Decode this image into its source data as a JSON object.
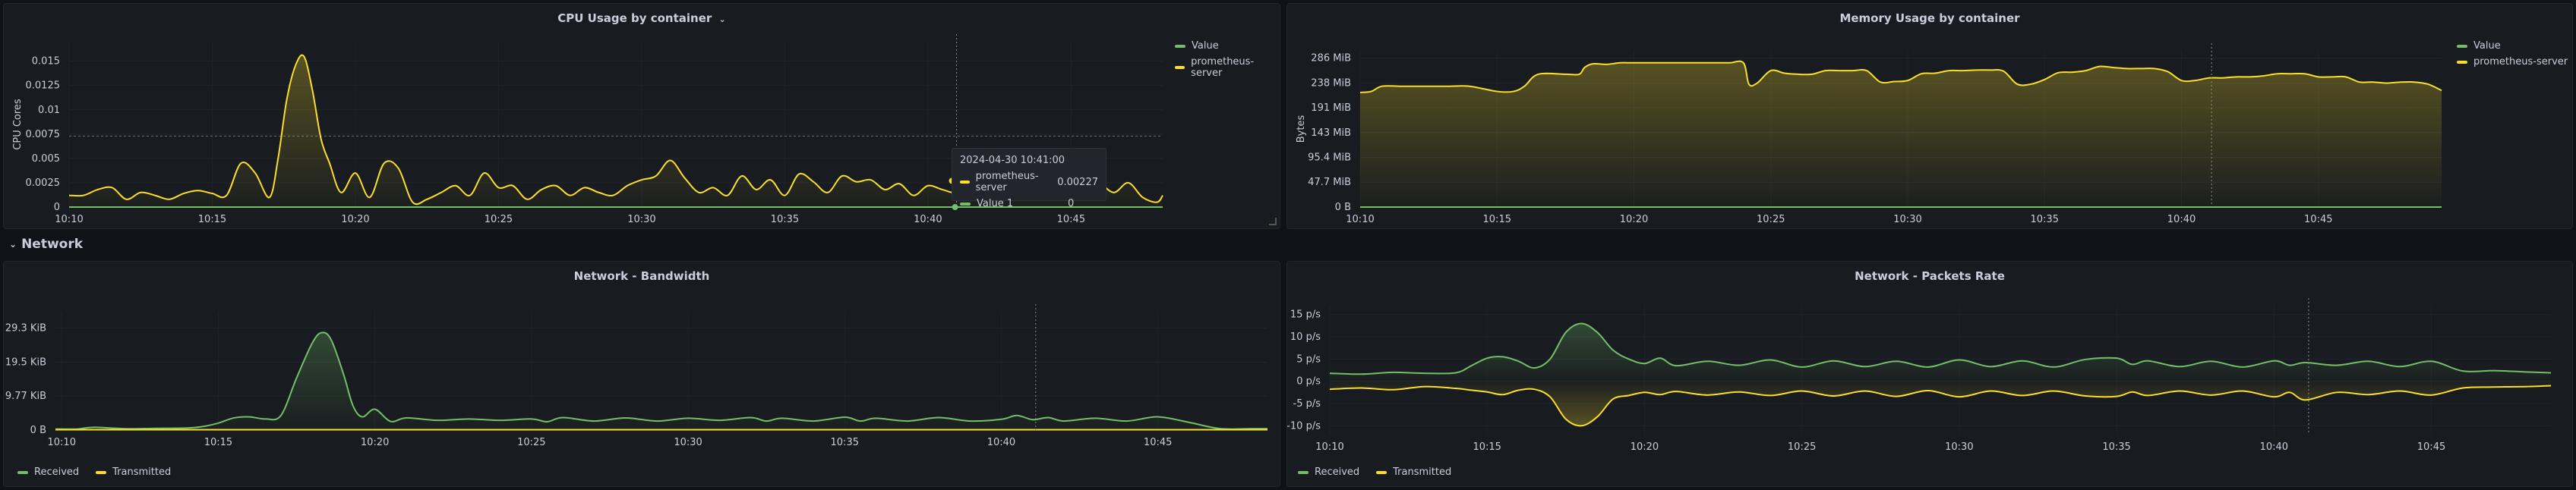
{
  "colors": {
    "green": "#73bf69",
    "yellow": "#fade2a",
    "bg": "#181b1f",
    "grid": "#2a2d33"
  },
  "row": {
    "label": "Network"
  },
  "panels": {
    "cpu": {
      "title": "CPU Usage by container",
      "legend": [
        "Value",
        "prometheus-server"
      ],
      "tooltip": {
        "time": "2024-04-30 10:41:00",
        "rows": [
          {
            "label": "prometheus-server",
            "value": "0.00227",
            "color": "#fade2a"
          },
          {
            "label": "Value 1",
            "value": "0",
            "color": "#73bf69"
          }
        ]
      }
    },
    "mem": {
      "title": "Memory Usage by container",
      "legend": [
        "Value",
        "prometheus-server"
      ]
    },
    "bw": {
      "title": "Network - Bandwidth",
      "legend": [
        "Received",
        "Transmitted"
      ]
    },
    "pkt": {
      "title": "Network - Packets Rate",
      "legend": [
        "Received",
        "Transmitted"
      ]
    }
  },
  "chart_data": [
    {
      "type": "line",
      "title": "CPU Usage by container",
      "ylabel": "CPU Cores",
      "ylim": [
        0,
        0.017
      ],
      "yticks": [
        "0",
        "0.0025",
        "0.005",
        "0.0075",
        "0.01",
        "0.0125",
        "0.015"
      ],
      "ytick_values": [
        0,
        0.0025,
        0.005,
        0.0075,
        0.01,
        0.0125,
        0.015
      ],
      "xlim": [
        10.0,
        48.2
      ],
      "xticks": [
        "10:10",
        "10:15",
        "10:20",
        "10:25",
        "10:30",
        "10:35",
        "10:40",
        "10:45"
      ],
      "xtick_values": [
        10,
        15,
        20,
        25,
        30,
        35,
        40,
        45
      ],
      "threshold_dashed": 0.0073,
      "cursor_x": 41.0,
      "series": [
        {
          "name": "Value",
          "color": "#73bf69",
          "x": [
            10,
            48.2
          ],
          "y": [
            0,
            0
          ]
        },
        {
          "name": "prometheus-server",
          "color": "#fade2a",
          "x": [
            10,
            10.5,
            11,
            11.5,
            12,
            12.5,
            13,
            13.5,
            14,
            14.5,
            15,
            15.5,
            16,
            16.5,
            17,
            17.3,
            17.6,
            17.9,
            18.2,
            18.5,
            18.8,
            19.1,
            19.5,
            20,
            20.5,
            21,
            21.5,
            22,
            22.5,
            23,
            23.5,
            24,
            24.5,
            25,
            25.5,
            26,
            26.5,
            27,
            27.5,
            28,
            28.5,
            29,
            29.5,
            30,
            30.5,
            31,
            31.5,
            32,
            32.5,
            33,
            33.5,
            34,
            34.5,
            35,
            35.5,
            36,
            36.5,
            37,
            37.5,
            38,
            38.5,
            39,
            39.5,
            40,
            40.5,
            41,
            41.5,
            42,
            42.5,
            43,
            43.5,
            44,
            44.5,
            45,
            45.5,
            46,
            46.5,
            47,
            47.5,
            48,
            48.2
          ],
          "y": [
            0.0012,
            0.0012,
            0.0018,
            0.002,
            0.0008,
            0.0015,
            0.0012,
            0.0008,
            0.0014,
            0.0017,
            0.0014,
            0.0012,
            0.0045,
            0.0035,
            0.001,
            0.005,
            0.011,
            0.0145,
            0.0155,
            0.012,
            0.007,
            0.0045,
            0.0015,
            0.0035,
            0.001,
            0.0045,
            0.004,
            0.0005,
            0.0008,
            0.0015,
            0.0022,
            0.0012,
            0.0035,
            0.002,
            0.0022,
            0.0008,
            0.0018,
            0.0022,
            0.0012,
            0.002,
            0.0015,
            0.0012,
            0.0022,
            0.0028,
            0.0032,
            0.0048,
            0.003,
            0.0015,
            0.002,
            0.0012,
            0.0032,
            0.0018,
            0.0028,
            0.0012,
            0.0034,
            0.0026,
            0.0015,
            0.0032,
            0.0026,
            0.0028,
            0.0018,
            0.0024,
            0.0012,
            0.0022,
            0.0018,
            0.0015,
            0.0025,
            0.0032,
            0.0015,
            0.0052,
            0.004,
            0.003,
            0.0055,
            0.0015,
            0.0032,
            0.0025,
            0.0015,
            0.0025,
            0.001,
            0.0005,
            0.0012
          ]
        }
      ]
    },
    {
      "type": "area",
      "title": "Memory Usage by container",
      "ylabel": "Bytes",
      "ylim": [
        0,
        300
      ],
      "yticks": [
        "0 B",
        "47.7 MiB",
        "95.4 MiB",
        "143 MiB",
        "191 MiB",
        "238 MiB",
        "286 MiB"
      ],
      "ytick_values": [
        0,
        47.7,
        95.4,
        143,
        191,
        238,
        286
      ],
      "xlim": [
        10.0,
        49.5
      ],
      "xticks": [
        "10:10",
        "10:15",
        "10:20",
        "10:25",
        "10:30",
        "10:35",
        "10:40",
        "10:45"
      ],
      "xtick_values": [
        10,
        15,
        20,
        25,
        30,
        35,
        40,
        45
      ],
      "cursor_x": 41.1,
      "series": [
        {
          "name": "Value",
          "color": "#73bf69",
          "x": [
            10,
            49.5
          ],
          "y": [
            0,
            0
          ]
        },
        {
          "name": "prometheus-server",
          "color": "#fade2a",
          "x": [
            10,
            10.4,
            10.8,
            11.5,
            12.5,
            13.2,
            14,
            15,
            15.6,
            16,
            16.5,
            17.5,
            18,
            18.2,
            18.5,
            19,
            19.5,
            20,
            21,
            22,
            23,
            23.5,
            24,
            24.2,
            24.5,
            25,
            25.5,
            26,
            26.5,
            27,
            27.5,
            28,
            28.5,
            29,
            29.5,
            30,
            30.5,
            31,
            31.5,
            32,
            32.5,
            33,
            33.5,
            34,
            34.5,
            35,
            35.5,
            36,
            36.5,
            37,
            37.5,
            38,
            38.5,
            39,
            39.5,
            40,
            40.5,
            41,
            41.5,
            42,
            42.5,
            43,
            43.5,
            44,
            44.5,
            45,
            45.5,
            46,
            46.5,
            47,
            47.5,
            48,
            48.5,
            49,
            49.5
          ],
          "y": [
            220,
            222,
            232,
            232,
            232,
            232,
            232,
            222,
            222,
            232,
            255,
            255,
            255,
            268,
            275,
            274,
            277,
            277,
            277,
            277,
            277,
            277,
            277,
            236,
            238,
            262,
            257,
            255,
            255,
            262,
            262,
            262,
            262,
            240,
            241,
            243,
            256,
            257,
            262,
            262,
            263,
            263,
            261,
            236,
            236,
            245,
            258,
            259,
            262,
            270,
            268,
            266,
            266,
            266,
            260,
            243,
            243,
            248,
            248,
            250,
            250,
            252,
            256,
            256,
            256,
            250,
            250,
            250,
            240,
            240,
            238,
            240,
            240,
            236,
            224
          ]
        }
      ]
    },
    {
      "type": "area",
      "title": "Network - Bandwidth",
      "ylim": [
        0,
        34
      ],
      "yticks": [
        "0 B",
        "9.77 KiB",
        "19.5 KiB",
        "29.3 KiB"
      ],
      "ytick_values": [
        0,
        9.77,
        19.5,
        29.3
      ],
      "xlim": [
        9.8,
        48.5
      ],
      "xticks": [
        "10:10",
        "10:15",
        "10:20",
        "10:25",
        "10:30",
        "10:35",
        "10:40",
        "10:45"
      ],
      "xtick_values": [
        10,
        15,
        20,
        25,
        30,
        35,
        40,
        45
      ],
      "cursor_x": 41.1,
      "series": [
        {
          "name": "Received",
          "color": "#73bf69",
          "x": [
            9.8,
            10.5,
            11,
            12,
            13,
            14,
            14.5,
            15,
            15.5,
            16,
            16.5,
            17,
            17.5,
            18,
            18.3,
            18.6,
            19,
            19.3,
            19.6,
            20,
            20.5,
            21,
            22,
            23,
            24,
            25,
            25.5,
            26,
            27,
            28,
            29,
            30,
            31,
            32,
            32.5,
            33,
            34,
            35,
            35.5,
            36,
            37,
            38,
            39,
            40,
            40.5,
            41,
            41.5,
            42,
            43,
            44,
            45,
            46,
            47,
            48,
            48.5
          ],
          "y": [
            0.3,
            0.3,
            0.8,
            0.4,
            0.5,
            0.6,
            1,
            2,
            3.5,
            3.8,
            3.2,
            4.2,
            15,
            25,
            28,
            26,
            16,
            7,
            3.8,
            6,
            2.5,
            3.5,
            2.8,
            3.2,
            2.8,
            3.2,
            2.4,
            3.6,
            2.6,
            3.5,
            2.6,
            3.4,
            2.8,
            3.6,
            2.6,
            3.4,
            2.6,
            3.7,
            2.6,
            3.4,
            2.6,
            3.6,
            2.6,
            3.1,
            4.2,
            3,
            3.6,
            2.6,
            3.4,
            2.6,
            3.8,
            2.2,
            0.4,
            0.4,
            0.4
          ]
        },
        {
          "name": "Transmitted",
          "color": "#fade2a",
          "x": [
            9.8,
            48.5
          ],
          "y": [
            0.1,
            0.1
          ]
        }
      ]
    },
    {
      "type": "area",
      "title": "Network - Packets Rate",
      "ylim": [
        -12,
        17
      ],
      "yticks": [
        "-10 p/s",
        "-5 p/s",
        "0 p/s",
        "5 p/s",
        "10 p/s",
        "15 p/s"
      ],
      "ytick_values": [
        -10,
        -5,
        0,
        5,
        10,
        15
      ],
      "xlim": [
        10,
        48.8
      ],
      "xticks": [
        "10:10",
        "10:15",
        "10:20",
        "10:25",
        "10:30",
        "10:35",
        "10:40",
        "10:45"
      ],
      "xtick_values": [
        10,
        15,
        20,
        25,
        30,
        35,
        40,
        45
      ],
      "cursor_x": 41.1,
      "series": [
        {
          "name": "Received",
          "color": "#73bf69",
          "x": [
            10,
            11,
            12,
            13,
            14,
            14.5,
            15,
            15.5,
            16,
            16.5,
            17,
            17.5,
            18,
            18.5,
            19,
            19.5,
            20,
            20.5,
            21,
            22,
            23,
            24,
            25,
            26,
            27,
            28,
            29,
            30,
            31,
            32,
            33,
            34,
            35,
            35.5,
            36,
            37,
            38,
            39,
            40,
            40.5,
            41,
            42,
            43,
            44,
            45,
            46,
            47,
            48,
            48.8
          ],
          "y": [
            1.8,
            1.6,
            2,
            1.8,
            1.9,
            3.5,
            5.2,
            5.5,
            4.5,
            3,
            5,
            11,
            13,
            11,
            7,
            5,
            4,
            5.2,
            3.5,
            4.5,
            3.6,
            4.8,
            3.2,
            4.6,
            3.3,
            4.5,
            3.2,
            4.8,
            3.3,
            4.6,
            3.2,
            4.9,
            5.2,
            3.8,
            4.6,
            3.3,
            4.5,
            3.2,
            4.6,
            3.6,
            4.2,
            3.6,
            4.5,
            3.3,
            4.5,
            2.3,
            2.4,
            2.1,
            1.9
          ]
        },
        {
          "name": "Transmitted",
          "color": "#fade2a",
          "x": [
            10,
            11,
            12,
            13,
            14,
            14.5,
            15,
            15.5,
            16,
            16.5,
            17,
            17.5,
            18,
            18.5,
            19,
            19.5,
            20,
            20.5,
            21,
            22,
            23,
            24,
            25,
            26,
            27,
            28,
            29,
            30,
            31,
            32,
            33,
            34,
            35,
            35.5,
            36,
            37,
            38,
            39,
            40,
            40.5,
            41,
            42,
            43,
            44,
            45,
            46,
            47,
            48,
            48.8
          ],
          "y": [
            -1.8,
            -1.5,
            -1.9,
            -1.2,
            -1.6,
            -2,
            -2.4,
            -3,
            -2,
            -1.8,
            -3.5,
            -8.5,
            -10,
            -8,
            -4,
            -3.2,
            -2.5,
            -3,
            -2.3,
            -3.1,
            -2.4,
            -3.2,
            -2.2,
            -3.3,
            -2.2,
            -3.4,
            -2.1,
            -3.5,
            -2.2,
            -3.2,
            -2.2,
            -3.3,
            -3.4,
            -2.4,
            -3.2,
            -2.2,
            -3.1,
            -2.2,
            -3.5,
            -2.5,
            -4.2,
            -2.5,
            -3,
            -2.2,
            -3.1,
            -1.5,
            -1.3,
            -1.2,
            -1
          ]
        }
      ]
    }
  ]
}
